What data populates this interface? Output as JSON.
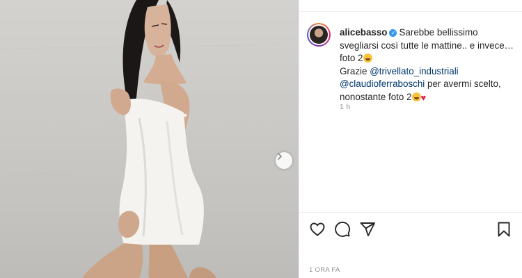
{
  "post": {
    "username": "alicebasso",
    "verified": true,
    "caption_line1": "Sarebbe bellissimo svegliarsi così tutte le mattine.. e invece… foto 2",
    "caption_thanks": "Grazie",
    "mention1": "@trivellato_industriali",
    "mention2": "@claudioferraboschi",
    "caption_tail": "per avermi scelto, nonostante foto 2",
    "comment_time": "1 h",
    "post_time": "1 ORA FA"
  },
  "icons": {
    "like": "heart-icon",
    "comment": "comment-icon",
    "share": "share-icon",
    "save": "bookmark-icon",
    "next": "chevron-right-icon"
  },
  "colors": {
    "mention": "#00376b",
    "verified": "#3897f0",
    "muted": "#8e8e8e",
    "heart_emoji": "#e0245e"
  }
}
